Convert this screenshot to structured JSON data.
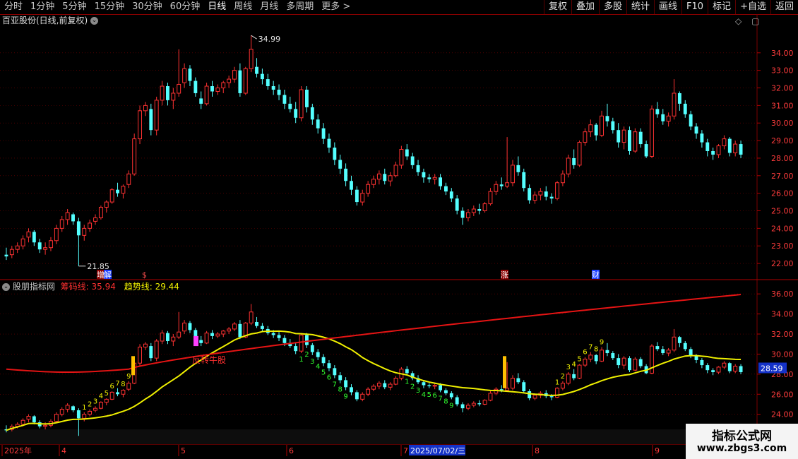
{
  "toolbar": {
    "periods": [
      "分时",
      "1分钟",
      "5分钟",
      "15分钟",
      "30分钟",
      "60分钟",
      "日线",
      "周线",
      "月线",
      "多周期",
      "更多 >"
    ],
    "active_period": "日线",
    "tools": [
      "复权",
      "叠加",
      "多股",
      "统计",
      "画线",
      "F10",
      "标记",
      "+自选",
      "返回"
    ]
  },
  "main_panel": {
    "title": "百亚股份(日线,前复权)",
    "high_label": "34.99",
    "low_label": "21.85",
    "markers": [
      "增",
      "解",
      "$",
      "涨",
      "财"
    ],
    "y_ticks": [
      "34.00",
      "33.00",
      "32.00",
      "31.00",
      "30.00",
      "29.00",
      "28.00",
      "27.00",
      "26.00",
      "25.00",
      "24.00",
      "23.00",
      "22.00"
    ]
  },
  "indicator_panel": {
    "name": "股朋指标网",
    "chip_label": "筹码线: 35.94",
    "trend_label": "趋势线: 29.44",
    "annotation": "反转牛股",
    "current_value": "28.59",
    "y_ticks": [
      "36.00",
      "34.00",
      "32.00",
      "30.00",
      "28.00",
      "26.00",
      "24.00"
    ]
  },
  "date_axis": {
    "labels": [
      "2025年",
      "4",
      "5",
      "6",
      "7",
      "8",
      "9"
    ],
    "cursor_date": "2025/07/02/三"
  },
  "watermark": {
    "line1": "指标公式网",
    "line2": "www.zbgs3.com"
  },
  "colors": {
    "up": "#ff3232",
    "down": "#54ffff",
    "chip_line": "#e51414",
    "trend_line": "#f0f000",
    "grid": "#7a0000",
    "bg": "#000000"
  },
  "chart_data": {
    "type": "candlestick",
    "price_range_main": [
      21.4,
      35.4
    ],
    "price_range_indicator": [
      22.5,
      37.0
    ],
    "ohlc": [
      [
        22.5,
        22.9,
        22.2,
        22.4
      ],
      [
        22.5,
        23.0,
        22.3,
        22.8
      ],
      [
        22.8,
        23.2,
        22.6,
        23.0
      ],
      [
        23.0,
        23.6,
        22.8,
        23.4
      ],
      [
        23.5,
        24.0,
        23.2,
        23.8
      ],
      [
        23.8,
        23.9,
        23.0,
        23.2
      ],
      [
        23.2,
        23.4,
        22.6,
        22.8
      ],
      [
        22.8,
        23.2,
        22.5,
        22.9
      ],
      [
        22.9,
        23.5,
        22.7,
        23.3
      ],
      [
        23.3,
        24.2,
        23.1,
        24.0
      ],
      [
        24.0,
        24.7,
        23.8,
        24.5
      ],
      [
        24.5,
        25.1,
        24.2,
        24.9
      ],
      [
        24.8,
        24.9,
        24.2,
        24.4
      ],
      [
        24.4,
        24.6,
        21.85,
        23.6
      ],
      [
        23.6,
        24.2,
        23.3,
        24.0
      ],
      [
        24.0,
        24.5,
        23.8,
        24.3
      ],
      [
        24.4,
        24.8,
        24.2,
        24.6
      ],
      [
        24.6,
        25.3,
        24.5,
        25.2
      ],
      [
        25.2,
        25.6,
        24.9,
        25.5
      ],
      [
        25.5,
        26.3,
        25.4,
        26.2
      ],
      [
        26.2,
        26.6,
        25.8,
        26.0
      ],
      [
        26.0,
        26.5,
        25.7,
        26.4
      ],
      [
        26.5,
        27.3,
        26.3,
        27.1
      ],
      [
        27.1,
        29.4,
        27.0,
        29.1
      ],
      [
        29.1,
        31.0,
        28.8,
        30.7
      ],
      [
        30.7,
        31.2,
        30.4,
        31.0
      ],
      [
        30.8,
        31.1,
        29.3,
        29.6
      ],
      [
        29.6,
        31.5,
        29.3,
        31.3
      ],
      [
        31.3,
        32.4,
        31.0,
        32.1
      ],
      [
        32.1,
        32.3,
        31.0,
        31.3
      ],
      [
        31.3,
        32.0,
        30.8,
        31.7
      ],
      [
        31.7,
        34.2,
        31.5,
        32.2
      ],
      [
        32.3,
        33.4,
        32.0,
        33.1
      ],
      [
        33.1,
        33.3,
        32.1,
        32.4
      ],
      [
        32.4,
        32.6,
        31.5,
        31.7
      ],
      [
        31.4,
        31.8,
        30.8,
        31.1
      ],
      [
        31.1,
        32.3,
        31.0,
        32.1
      ],
      [
        32.1,
        32.4,
        31.5,
        31.8
      ],
      [
        31.8,
        32.2,
        31.6,
        32.0
      ],
      [
        32.0,
        32.4,
        31.7,
        32.3
      ],
      [
        32.3,
        32.7,
        32.0,
        32.5
      ],
      [
        32.5,
        33.2,
        32.3,
        33.0
      ],
      [
        33.0,
        33.4,
        31.5,
        31.7
      ],
      [
        31.7,
        33.2,
        31.6,
        33.1
      ],
      [
        33.1,
        34.99,
        32.9,
        34.2
      ],
      [
        33.2,
        33.7,
        32.6,
        32.8
      ],
      [
        32.8,
        33.1,
        32.2,
        32.5
      ],
      [
        32.5,
        32.8,
        31.9,
        32.1
      ],
      [
        32.1,
        32.4,
        31.6,
        31.9
      ],
      [
        31.9,
        32.2,
        31.3,
        31.6
      ],
      [
        31.6,
        31.9,
        30.8,
        31.1
      ],
      [
        31.1,
        31.5,
        30.6,
        30.8
      ],
      [
        30.8,
        31.2,
        30.0,
        30.3
      ],
      [
        30.3,
        32.1,
        30.1,
        31.9
      ],
      [
        31.9,
        32.1,
        30.6,
        30.9
      ],
      [
        30.9,
        31.1,
        29.9,
        30.2
      ],
      [
        30.2,
        30.5,
        29.4,
        29.7
      ],
      [
        29.7,
        30.0,
        28.8,
        29.1
      ],
      [
        29.1,
        29.4,
        28.3,
        28.6
      ],
      [
        28.6,
        28.9,
        27.6,
        27.9
      ],
      [
        27.9,
        28.2,
        27.1,
        27.4
      ],
      [
        27.4,
        27.7,
        26.4,
        26.7
      ],
      [
        26.7,
        27.0,
        25.9,
        26.2
      ],
      [
        26.2,
        26.4,
        25.3,
        25.5
      ],
      [
        25.5,
        26.2,
        25.3,
        26.0
      ],
      [
        26.0,
        26.7,
        25.8,
        26.5
      ],
      [
        26.5,
        27.0,
        26.3,
        26.8
      ],
      [
        26.8,
        27.3,
        26.5,
        27.1
      ],
      [
        27.1,
        27.4,
        26.5,
        26.7
      ],
      [
        26.7,
        27.2,
        26.4,
        27.0
      ],
      [
        27.0,
        27.8,
        26.9,
        27.6
      ],
      [
        27.6,
        28.7,
        27.4,
        28.5
      ],
      [
        28.5,
        28.8,
        27.9,
        28.1
      ],
      [
        28.1,
        28.3,
        27.4,
        27.6
      ],
      [
        27.6,
        27.9,
        27.0,
        27.2
      ],
      [
        27.2,
        27.4,
        26.6,
        26.9
      ],
      [
        26.9,
        27.1,
        26.6,
        26.8
      ],
      [
        26.8,
        27.1,
        26.5,
        26.9
      ],
      [
        26.9,
        27.1,
        26.2,
        26.4
      ],
      [
        26.4,
        26.6,
        25.9,
        26.1
      ],
      [
        26.1,
        26.3,
        25.5,
        25.7
      ],
      [
        25.7,
        25.9,
        24.8,
        25.0
      ],
      [
        25.0,
        25.2,
        24.2,
        24.6
      ],
      [
        24.6,
        25.1,
        24.4,
        24.9
      ],
      [
        24.9,
        25.3,
        24.7,
        25.1
      ],
      [
        25.1,
        25.4,
        24.8,
        25.0
      ],
      [
        25.0,
        25.5,
        24.9,
        25.4
      ],
      [
        25.4,
        26.3,
        25.3,
        26.1
      ],
      [
        26.1,
        26.7,
        25.9,
        26.5
      ],
      [
        26.5,
        26.9,
        26.2,
        26.4
      ],
      [
        26.4,
        29.2,
        26.3,
        26.6
      ],
      [
        26.6,
        27.9,
        26.4,
        27.6
      ],
      [
        27.6,
        28.1,
        27.0,
        27.2
      ],
      [
        27.2,
        27.4,
        26.1,
        26.3
      ],
      [
        26.3,
        26.5,
        25.4,
        25.6
      ],
      [
        25.6,
        26.1,
        25.4,
        25.9
      ],
      [
        25.9,
        26.3,
        25.6,
        26.1
      ],
      [
        26.1,
        26.4,
        25.6,
        25.8
      ],
      [
        25.8,
        26.0,
        25.4,
        25.7
      ],
      [
        25.7,
        26.7,
        25.6,
        26.6
      ],
      [
        26.6,
        27.3,
        26.4,
        27.1
      ],
      [
        27.1,
        28.2,
        26.9,
        28.0
      ],
      [
        28.0,
        28.5,
        27.4,
        27.6
      ],
      [
        27.6,
        29.0,
        27.5,
        28.9
      ],
      [
        28.9,
        29.7,
        28.7,
        29.5
      ],
      [
        29.5,
        30.2,
        29.2,
        29.9
      ],
      [
        29.9,
        30.0,
        29.0,
        29.3
      ],
      [
        29.3,
        30.7,
        29.2,
        30.4
      ],
      [
        30.4,
        31.1,
        29.8,
        30.1
      ],
      [
        30.1,
        30.3,
        29.4,
        29.6
      ],
      [
        29.6,
        30.0,
        28.6,
        28.9
      ],
      [
        28.9,
        29.8,
        28.5,
        29.6
      ],
      [
        29.6,
        29.8,
        28.2,
        28.4
      ],
      [
        28.4,
        29.7,
        28.3,
        29.5
      ],
      [
        29.5,
        29.7,
        28.6,
        28.8
      ],
      [
        28.8,
        29.0,
        28.0,
        28.1
      ],
      [
        28.1,
        31.0,
        28.0,
        30.8
      ],
      [
        30.8,
        31.2,
        30.3,
        30.5
      ],
      [
        30.5,
        30.8,
        29.9,
        30.1
      ],
      [
        30.1,
        30.6,
        29.8,
        30.4
      ],
      [
        30.4,
        32.5,
        30.2,
        31.7
      ],
      [
        31.7,
        31.8,
        30.7,
        31.1
      ],
      [
        31.1,
        31.3,
        30.3,
        30.5
      ],
      [
        30.5,
        30.7,
        29.6,
        29.8
      ],
      [
        29.8,
        30.0,
        29.1,
        29.4
      ],
      [
        29.4,
        29.6,
        28.6,
        28.9
      ],
      [
        28.9,
        29.1,
        28.1,
        28.4
      ],
      [
        28.4,
        28.6,
        27.9,
        28.2
      ],
      [
        28.2,
        28.8,
        28.0,
        28.7
      ],
      [
        28.7,
        29.3,
        28.5,
        29.1
      ],
      [
        29.1,
        29.2,
        28.1,
        28.3
      ],
      [
        28.3,
        29.0,
        28.1,
        28.8
      ],
      [
        28.8,
        29.0,
        28.0,
        28.2
      ]
    ]
  }
}
